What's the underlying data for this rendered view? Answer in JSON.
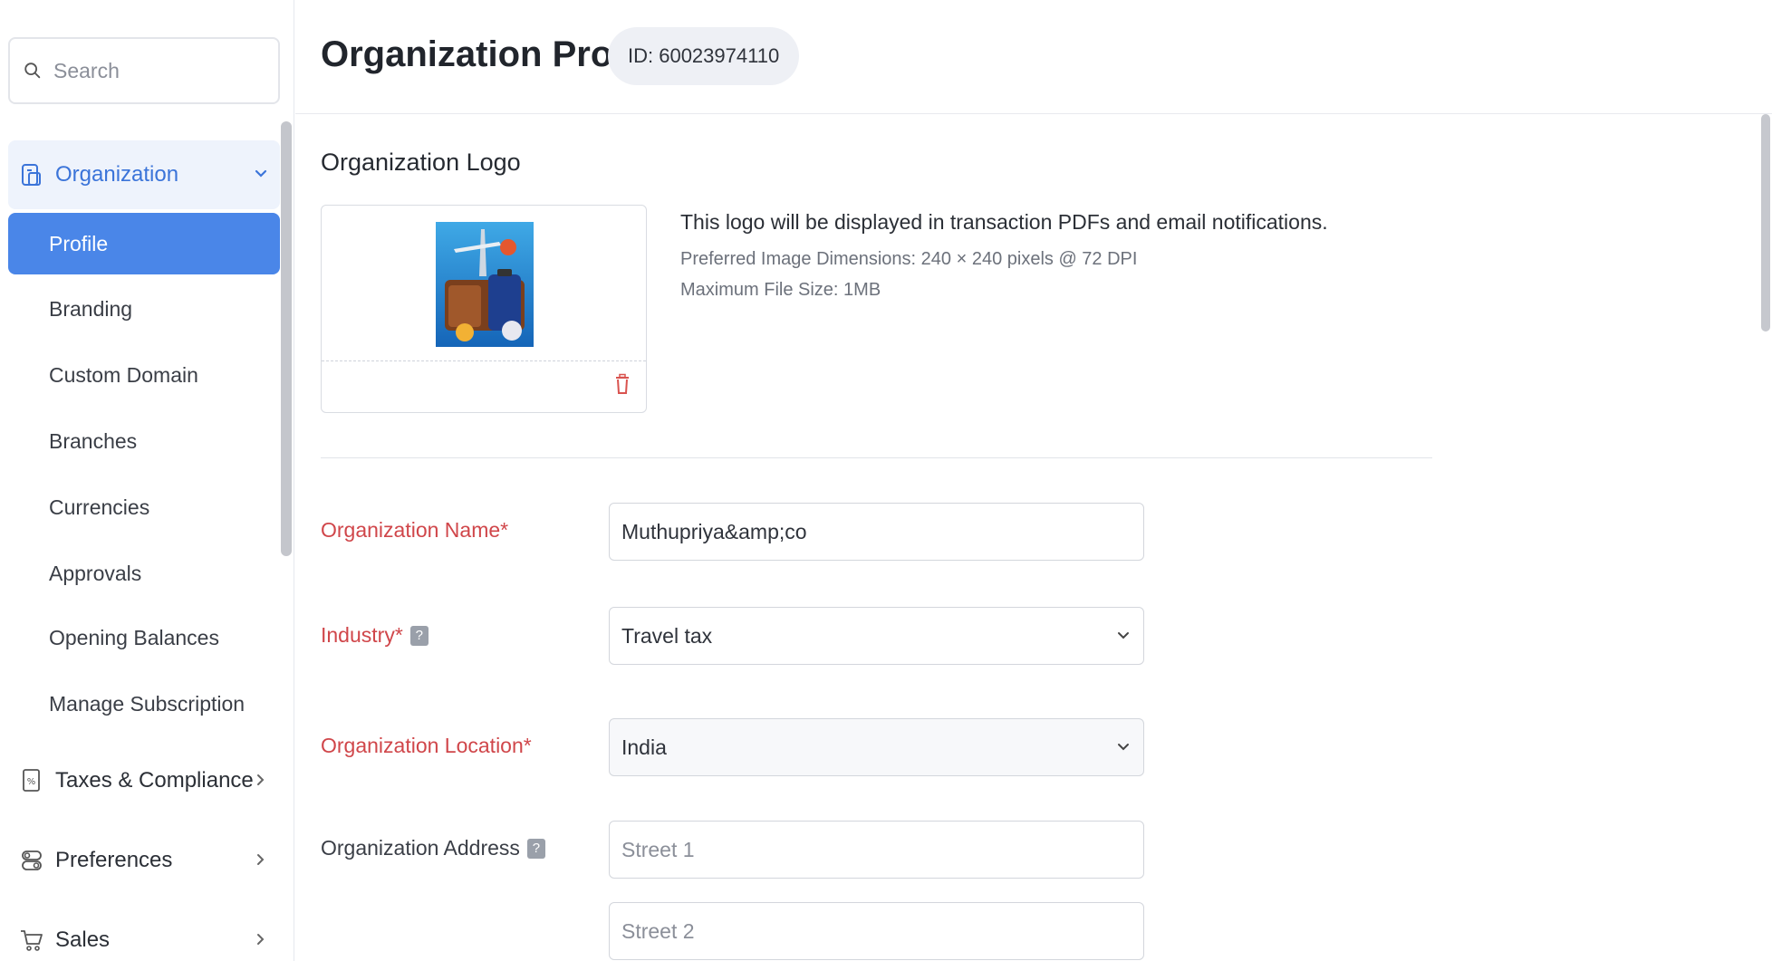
{
  "search": {
    "placeholder": "Search"
  },
  "sidebar": {
    "organization": {
      "label": "Organization",
      "items": [
        {
          "label": "Profile"
        },
        {
          "label": "Branding"
        },
        {
          "label": "Custom Domain"
        },
        {
          "label": "Branches"
        },
        {
          "label": "Currencies"
        },
        {
          "label": "Approvals"
        },
        {
          "label": "Opening Balances"
        },
        {
          "label": "Manage Subscription"
        }
      ]
    },
    "groups": [
      {
        "label": "Taxes & Compliance"
      },
      {
        "label": "Preferences"
      },
      {
        "label": "Sales"
      }
    ]
  },
  "header": {
    "title": "Organization Profile",
    "id_badge": "ID: 60023974110"
  },
  "logo": {
    "section_title": "Organization Logo",
    "description": "This logo will be displayed in transaction PDFs and email notifications.",
    "dimensions_hint": "Preferred Image Dimensions: 240 × 240 pixels @ 72 DPI",
    "size_hint": "Maximum File Size: 1MB"
  },
  "form": {
    "org_name": {
      "label": "Organization Name*",
      "value": "Muthupriya&amp;co"
    },
    "industry": {
      "label": "Industry*",
      "value": "Travel tax"
    },
    "location": {
      "label": "Organization Location*",
      "value": "India"
    },
    "address": {
      "label": "Organization Address",
      "street1_placeholder": "Street 1",
      "street2_placeholder": "Street 2"
    }
  },
  "colors": {
    "accent": "#4a86e8",
    "required_label": "#d0464a"
  }
}
